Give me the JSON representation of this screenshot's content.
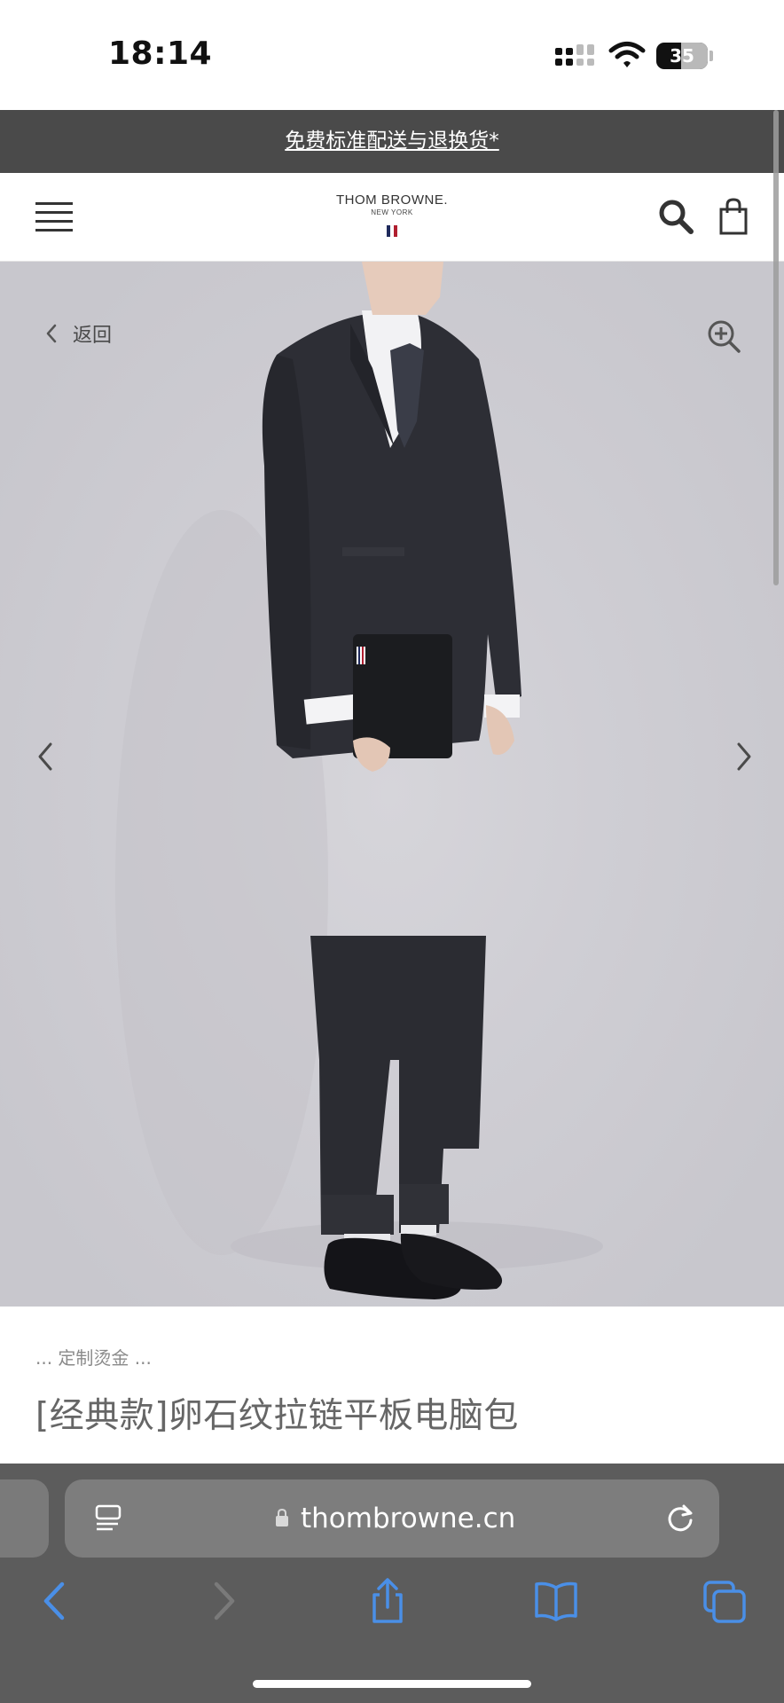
{
  "status_bar": {
    "time": "18:14",
    "battery_level": "35",
    "icons": [
      "cellular-signal-icon",
      "wifi-icon",
      "battery-icon"
    ]
  },
  "promo_bar": {
    "text": "免费标准配送与退换货*"
  },
  "header": {
    "logo_main": "THOM BROWNE.",
    "logo_sub": "NEW YORK",
    "flag_colors": [
      "#1f2a5c",
      "#ffffff",
      "#b01e2f"
    ],
    "icons": [
      "hamburger-menu-icon",
      "search-icon",
      "shopping-bag-icon"
    ]
  },
  "product_image": {
    "back_label": "返回",
    "icons": [
      "back-chevron-icon",
      "zoom-in-icon",
      "previous-image-arrow-icon",
      "next-image-arrow-icon"
    ]
  },
  "product": {
    "tagline": "... 定制烫金 ...",
    "title": "[经典款]卵石纹拉链平板电脑包"
  },
  "browser": {
    "url": "thombrowne.cn",
    "icons": [
      "reader-mode-icon",
      "lock-icon",
      "reload-icon",
      "back-icon",
      "forward-icon",
      "share-icon",
      "bookmarks-icon",
      "tabs-icon"
    ],
    "accent_color": "#4a8fe7"
  }
}
